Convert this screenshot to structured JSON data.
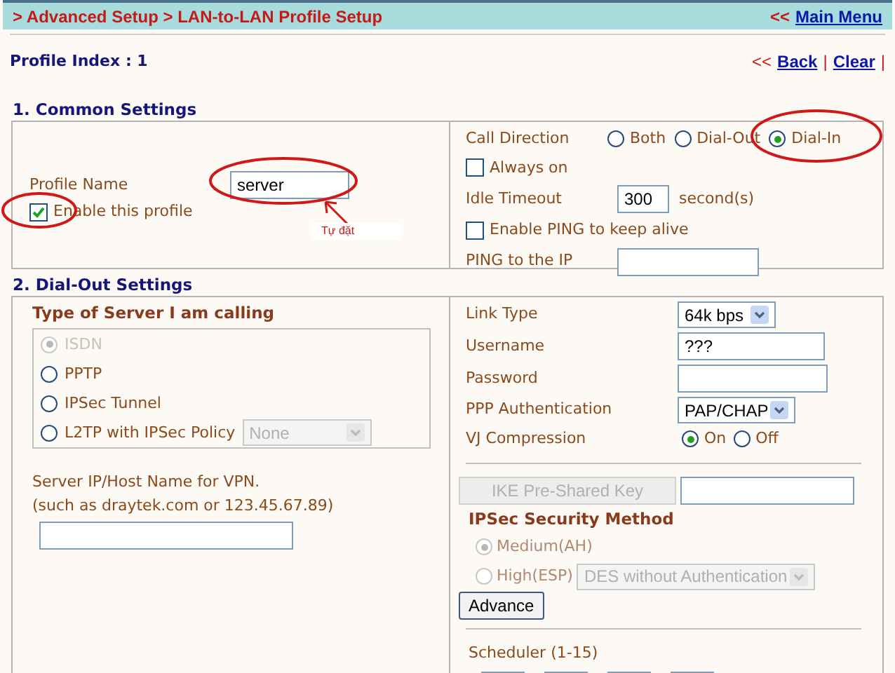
{
  "header": {
    "breadcrumb": "> Advanced Setup > LAN-to-LAN Profile Setup",
    "main_menu_prefix": "<<",
    "main_menu": "Main Menu"
  },
  "profile_index": "Profile Index : 1",
  "nav": {
    "prefix": "<<",
    "links": [
      {
        "label": "Back"
      },
      {
        "label": "Clear"
      }
    ],
    "separator": "|"
  },
  "common": {
    "title": "1. Common Settings",
    "profile_name": {
      "label": "Profile Name",
      "value": "server"
    },
    "enable_profile": {
      "label": "Enable this profile",
      "checked": true
    },
    "call_direction": {
      "label": "Call Direction",
      "options": [
        {
          "label": "Both",
          "selected": false
        },
        {
          "label": "Dial-Out",
          "selected": false
        },
        {
          "label": "Dial-In",
          "selected": true
        }
      ]
    },
    "always_on": {
      "label": "Always on",
      "checked": false
    },
    "idle_timeout": {
      "label": "Idle Timeout",
      "value": "300",
      "unit": "second(s)"
    },
    "enable_ping": {
      "label": "Enable PING to keep alive",
      "checked": false
    },
    "ping_ip": {
      "label": "PING to the IP"
    }
  },
  "annotation": {
    "text": "Tự đặt"
  },
  "dial_out": {
    "title": "2. Dial-Out Settings",
    "server_type": {
      "title": "Type of Server I am calling",
      "options": [
        {
          "label": "ISDN",
          "selected": true,
          "disabled": true
        },
        {
          "label": "PPTP",
          "selected": false,
          "disabled": false
        },
        {
          "label": "IPSec Tunnel",
          "selected": false,
          "disabled": false
        },
        {
          "label": "L2TP with IPSec Policy",
          "selected": false,
          "disabled": false,
          "select": "None"
        }
      ]
    },
    "server_host": {
      "label": "Server IP/Host Name for VPN.",
      "hint": "(such as draytek.com or 123.45.67.89)"
    },
    "link_type": {
      "label": "Link Type",
      "value": "64k bps"
    },
    "username": {
      "label": "Username",
      "value": "???"
    },
    "password": {
      "label": "Password"
    },
    "ppp_auth": {
      "label": "PPP Authentication",
      "value": "PAP/CHAP"
    },
    "vj": {
      "label": "VJ Compression",
      "options": [
        {
          "label": "On",
          "selected": true
        },
        {
          "label": "Off",
          "selected": false
        }
      ]
    },
    "ike_button": "IKE Pre-Shared Key",
    "ipsec_method": {
      "title": "IPSec Security Method",
      "options": [
        {
          "label": "Medium(AH)",
          "selected": true,
          "disabled": true
        },
        {
          "label": "High(ESP)",
          "selected": false,
          "disabled": true,
          "select": "DES without Authentication"
        }
      ]
    },
    "advance_button": "Advance",
    "scheduler": {
      "label": "Scheduler (1-15)"
    }
  }
}
